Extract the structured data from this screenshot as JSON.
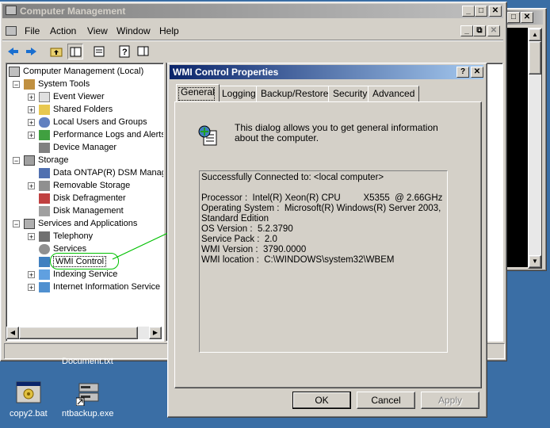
{
  "main_window": {
    "title": "Computer Management",
    "menu": [
      "File",
      "Action",
      "View",
      "Window",
      "Help"
    ]
  },
  "tree": {
    "root": "Computer Management (Local)",
    "items": [
      "System Tools",
      "Event Viewer",
      "Shared Folders",
      "Local Users and Groups",
      "Performance Logs and Alerts",
      "Device Manager",
      "Storage",
      "Data ONTAP(R) DSM Manag",
      "Removable Storage",
      "Disk Defragmenter",
      "Disk Management",
      "Services and Applications",
      "Telephony",
      "Services",
      "WMI Control",
      "Indexing Service",
      "Internet Information Service"
    ]
  },
  "dialog": {
    "title": "WMI Control Properties",
    "tabs": [
      "General",
      "Logging",
      "Backup/Restore",
      "Security",
      "Advanced"
    ],
    "active_tab": "General",
    "description": "This dialog allows you to get general information about the computer.",
    "info_lines": [
      "Successfully Connected to: <local computer>",
      "",
      "Processor :  Intel(R) Xeon(R) CPU         X5355  @ 2.66GHz",
      "Operating System :  Microsoft(R) Windows(R) Server 2003,",
      "Standard Edition",
      "OS Version :  5.2.3790",
      "Service Pack :  2.0",
      "WMI Version :  3790.0000",
      "WMI location :  C:\\WINDOWS\\system32\\WBEM"
    ],
    "buttons": {
      "ok": "OK",
      "cancel": "Cancel",
      "apply": "Apply"
    }
  },
  "desktop": {
    "icons": [
      "copy2.bat",
      "ntbackup.exe"
    ],
    "partial_label": "Document.txt"
  },
  "colors": {
    "desktop": "#3a6ea5",
    "active_title": "#0a246a",
    "highlight": "#00c000"
  }
}
